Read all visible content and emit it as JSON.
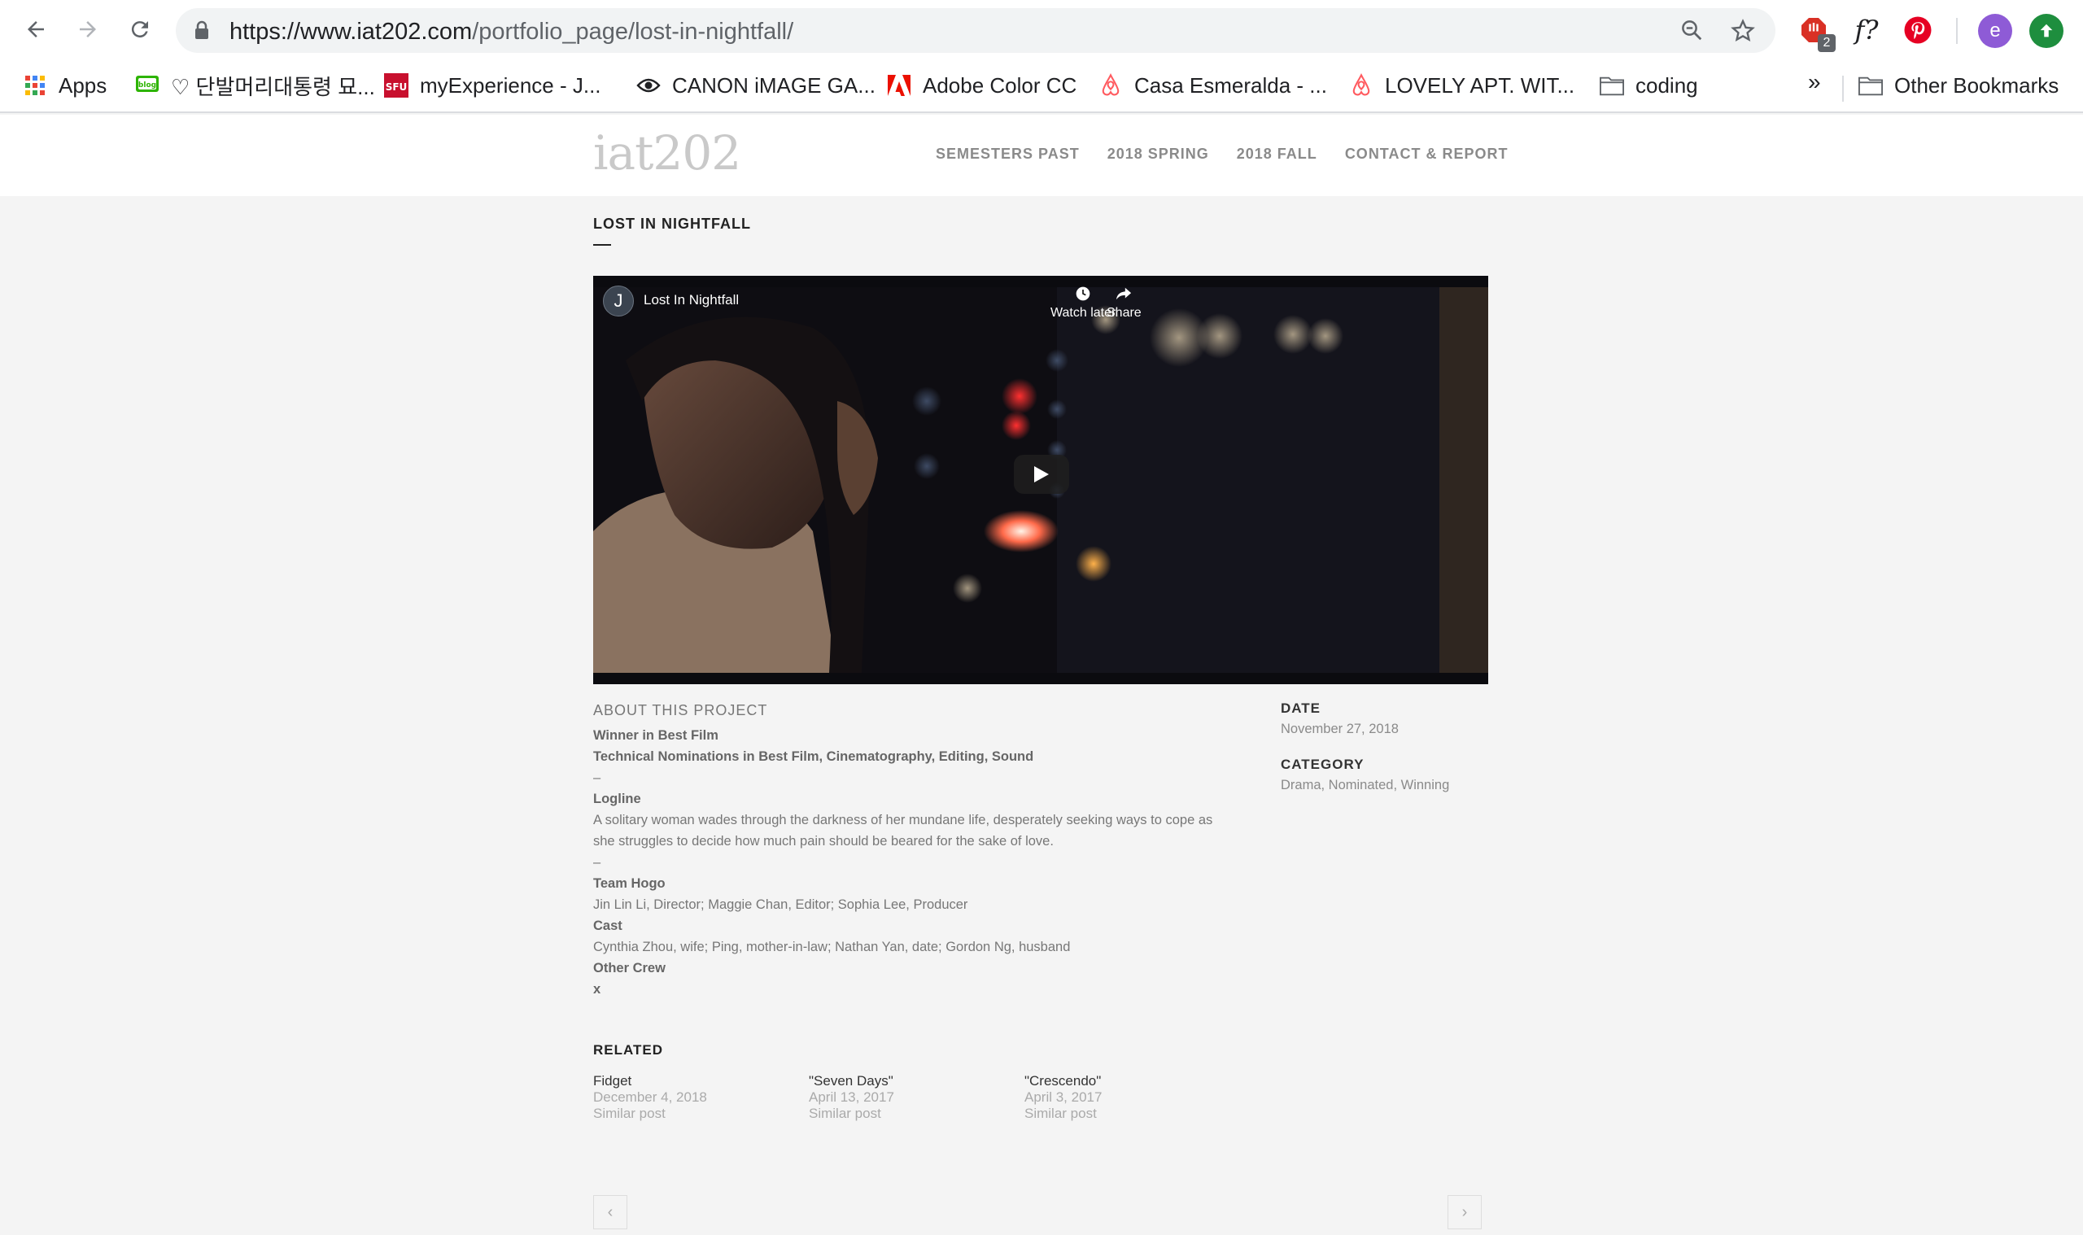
{
  "browser": {
    "url_host": "https://www.iat202.com",
    "url_path": "/portfolio_page/lost-in-nightfall/",
    "extension_badge": "2",
    "fq_label": "f?",
    "profile_letter": "e",
    "bookmarks": [
      {
        "label": "Apps",
        "icon": "apps-grid-icon"
      },
      {
        "label": "♡ 단발머리대통령 묘...",
        "icon": "blog-icon"
      },
      {
        "label": "myExperience - J...",
        "icon": "sfu-icon"
      },
      {
        "label": "CANON iMAGE GA...",
        "icon": "eye-icon"
      },
      {
        "label": "Adobe Color CC",
        "icon": "adobe-icon"
      },
      {
        "label": "Casa Esmeralda - ...",
        "icon": "airbnb-icon"
      },
      {
        "label": "LOVELY APT. WIT...",
        "icon": "airbnb-icon"
      },
      {
        "label": "coding",
        "icon": "folder-icon"
      }
    ],
    "more_label": "»",
    "other_bookmarks": "Other Bookmarks"
  },
  "site": {
    "logo": "iat202",
    "nav": [
      "SEMESTERS PAST",
      "2018 SPRING",
      "2018 FALL",
      "CONTACT & REPORT"
    ],
    "page_title": "LOST IN NIGHTFALL"
  },
  "video": {
    "channel_letter": "J",
    "title": "Lost In Nightfall",
    "watch_later": "Watch later",
    "share": "Share"
  },
  "about": {
    "label": "ABOUT THIS PROJECT",
    "award": "Winner in Best Film",
    "nominations": "Technical Nominations in Best Film, Cinematography, Editing, Sound",
    "dash1": "–",
    "logline_label": "Logline",
    "logline": "A solitary woman wades through the darkness of her mundane life, desperately seeking ways to cope as she struggles to decide how much pain should be beared for the sake of love.",
    "dash2": "–",
    "team_label": "Team Hogo",
    "team": "Jin Lin Li, Director; Maggie Chan, Editor; Sophia Lee, Producer",
    "cast_label": "Cast",
    "cast": "Cynthia Zhou, wife; Ping, mother-in-law; Nathan Yan, date; Gordon Ng, husband",
    "crew_label": "Other Crew",
    "crew": "x"
  },
  "meta": {
    "date_label": "DATE",
    "date": "November 27, 2018",
    "category_label": "CATEGORY",
    "category": "Drama, Nominated, Winning"
  },
  "related": {
    "title": "RELATED",
    "items": [
      {
        "title": "Fidget",
        "date": "December 4, 2018",
        "note": "Similar post"
      },
      {
        "title": "\"Seven Days\"",
        "date": "April 13, 2017",
        "note": "Similar post"
      },
      {
        "title": "\"Crescendo\"",
        "date": "April 3, 2017",
        "note": "Similar post"
      }
    ]
  },
  "pager": {
    "prev": "‹",
    "next": "›"
  }
}
